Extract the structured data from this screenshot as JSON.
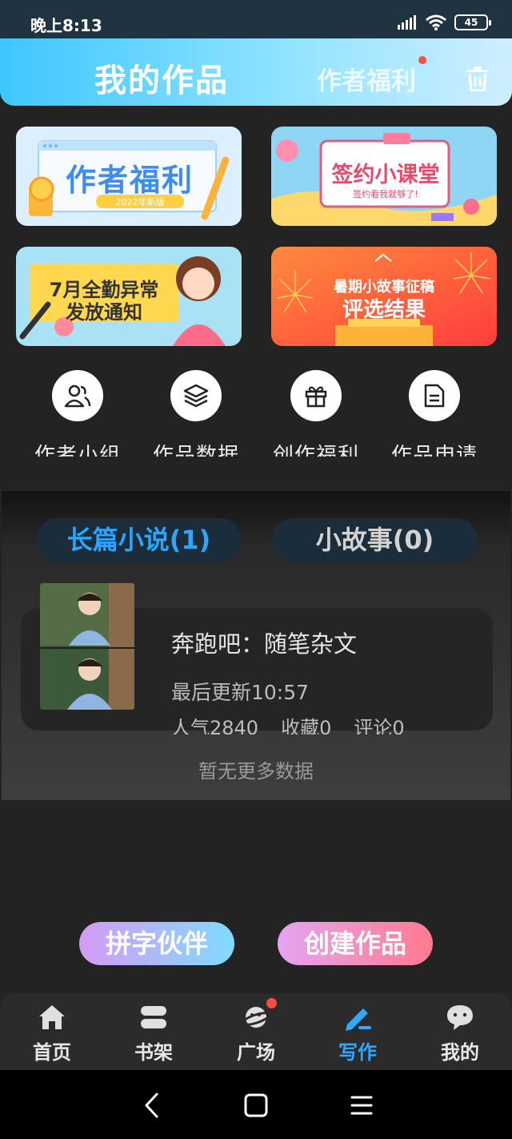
{
  "status_bar": {
    "time": "晚上8:13",
    "battery": "45"
  },
  "header": {
    "title": "我的作品",
    "tab_welfare": "作者福利"
  },
  "banners": [
    {
      "title": "作者福利",
      "subtitle": "2022年新版"
    },
    {
      "title": "签约小课堂",
      "subtitle": "签约看我就够了!"
    },
    {
      "title_line1": "7月全勤异常",
      "title_line2": "发放通知"
    },
    {
      "title_line1": "暑期小故事征稿",
      "title_line2": "评选结果"
    }
  ],
  "quick_actions": [
    {
      "label": "作者小组",
      "icon": "group-icon"
    },
    {
      "label": "作品数据",
      "icon": "layers-icon"
    },
    {
      "label": "创作福利",
      "icon": "gift-icon"
    },
    {
      "label": "作品申请",
      "icon": "document-icon"
    }
  ],
  "segments": {
    "novel": "长篇小说(1)",
    "story": "小故事(0)"
  },
  "book": {
    "title": "奔跑吧：随笔杂文",
    "last_update": "最后更新10:57",
    "popularity": "人气2840",
    "favorites": "收藏0",
    "comments": "评论0"
  },
  "no_more": "暂无更多数据",
  "buttons": {
    "partner": "拼字伙伴",
    "create": "创建作品"
  },
  "nav": [
    {
      "label": "首页",
      "icon": "home-icon"
    },
    {
      "label": "书架",
      "icon": "bookshelf-icon"
    },
    {
      "label": "广场",
      "icon": "planet-icon"
    },
    {
      "label": "写作",
      "icon": "pen-icon"
    },
    {
      "label": "我的",
      "icon": "chat-face-icon"
    }
  ],
  "colors": {
    "accent": "#30a8ff",
    "background": "#232323",
    "badge": "#ff4d3b"
  }
}
